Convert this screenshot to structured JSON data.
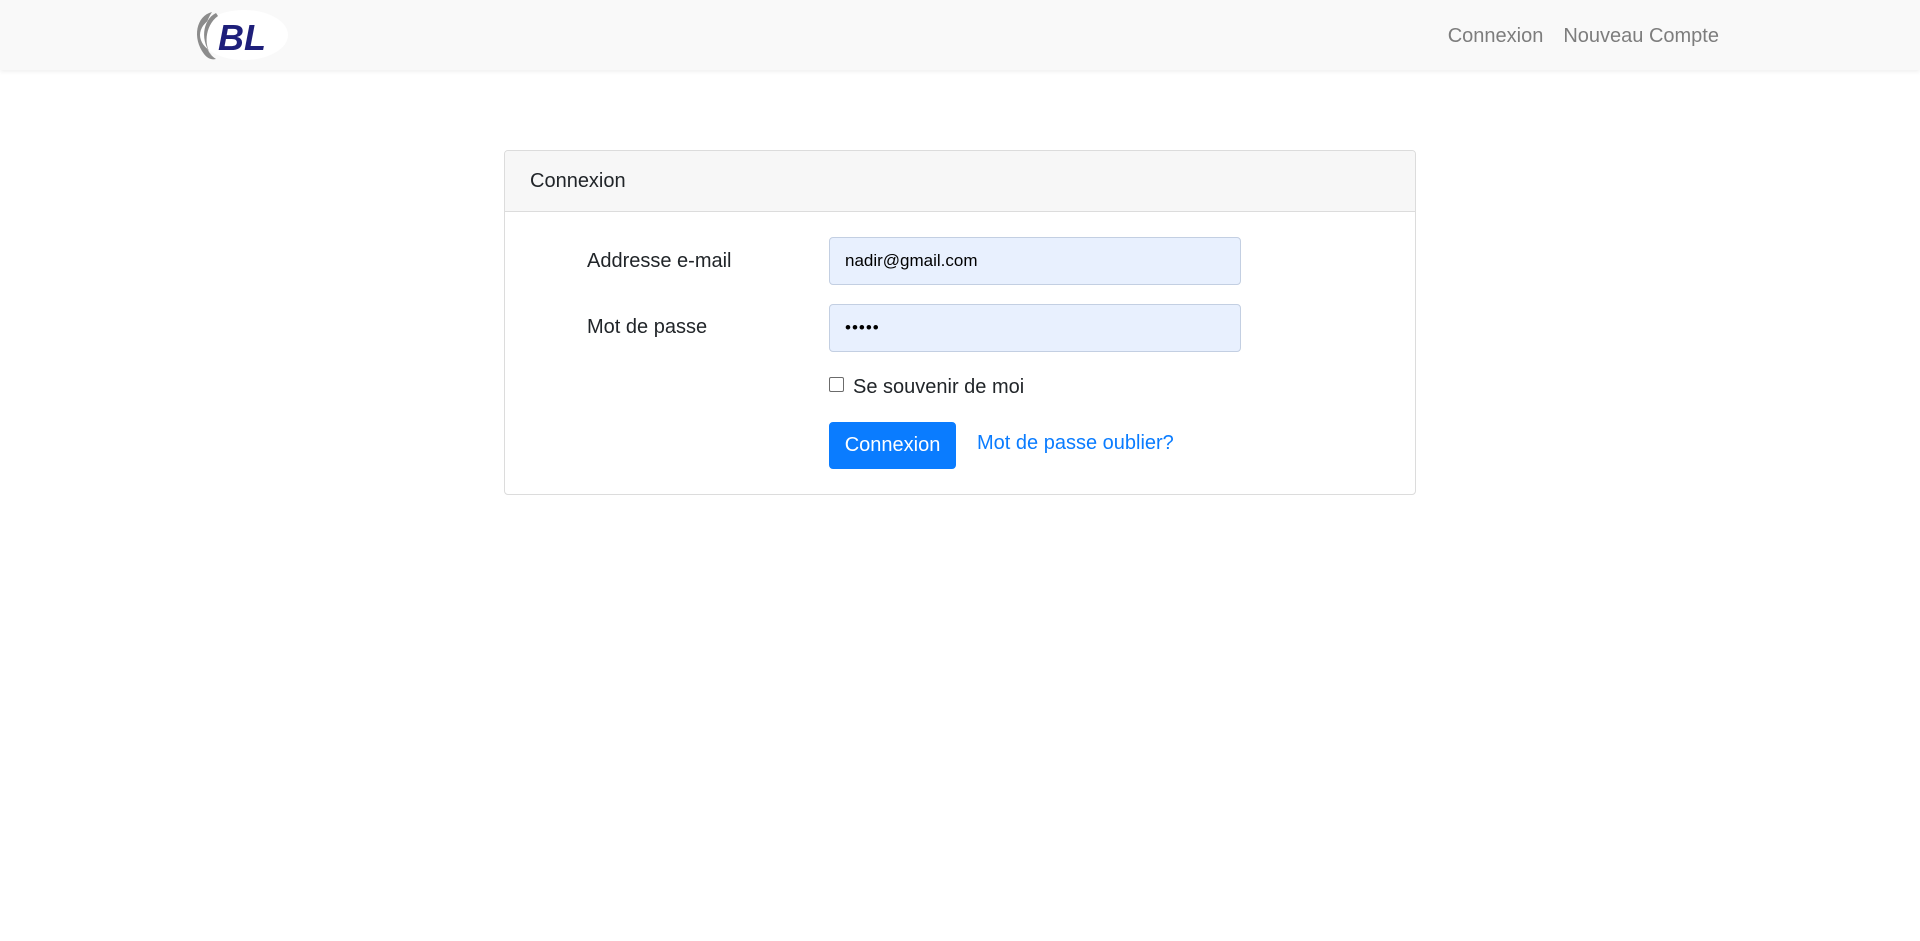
{
  "brand": {
    "logo_text": "BL",
    "logo_icon": "bl-logo-icon"
  },
  "nav": {
    "items": [
      {
        "label": "Connexion"
      },
      {
        "label": "Nouveau Compte"
      }
    ]
  },
  "login_card": {
    "header": "Connexion",
    "email": {
      "label": "Addresse e-mail",
      "value": "nadir@gmail.com"
    },
    "password": {
      "label": "Mot de passe",
      "value": "•••••"
    },
    "remember": {
      "label": "Se souvenir de moi",
      "checked": false
    },
    "submit_label": "Connexion",
    "forgot_label": "Mot de passe oublier?"
  },
  "colors": {
    "primary": "#0a7cff",
    "navbar_bg": "#f9f9f9",
    "input_autofill_bg": "#e8f0fe",
    "logo_navy": "#1e1f7a",
    "logo_gray": "#8c8c8c"
  }
}
